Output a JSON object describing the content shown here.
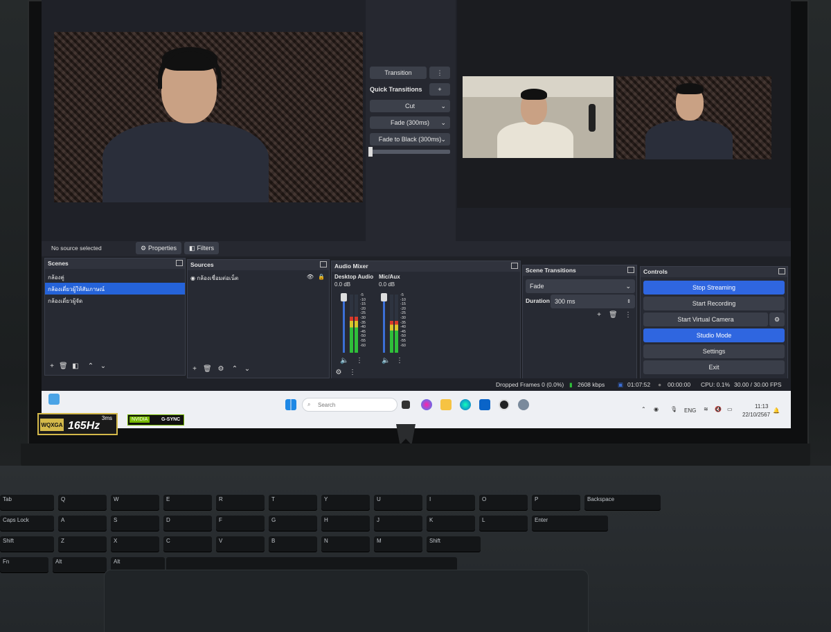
{
  "obs": {
    "transition_label": "Transition",
    "quick_transitions_label": "Quick Transitions",
    "quick_items": [
      "Cut",
      "Fade (300ms)",
      "Fade to Black (300ms)"
    ],
    "no_source_text": "No source selected",
    "properties_label": "Properties",
    "filters_label": "Filters"
  },
  "scenes": {
    "title": "Scenes",
    "items": [
      "กล้องคู่",
      "กล้องเดี่ยวผู้ให้สัมภาษณ์",
      "กล้องเดี่ยวผู้จัด"
    ],
    "selected_index": 1
  },
  "sources": {
    "title": "Sources",
    "items": [
      "กล้องเชื่อมต่อเน็ต"
    ]
  },
  "audio_mixer": {
    "title": "Audio Mixer",
    "channels": [
      {
        "name": "Desktop Audio",
        "db": "0.0 dB"
      },
      {
        "name": "Mic/Aux",
        "db": "0.0 dB"
      }
    ],
    "scale": [
      "-5",
      "-10",
      "-15",
      "-20",
      "-25",
      "-30",
      "-35",
      "-40",
      "-45",
      "-50",
      "-55",
      "-60"
    ]
  },
  "scene_transitions": {
    "title": "Scene Transitions",
    "selected": "Fade",
    "duration_label": "Duration",
    "duration_value": "300 ms"
  },
  "controls": {
    "title": "Controls",
    "buttons": [
      "Stop Streaming",
      "Start Recording",
      "Start Virtual Camera",
      "Studio Mode",
      "Settings",
      "Exit"
    ],
    "active": [
      "Stop Streaming",
      "Studio Mode"
    ]
  },
  "status": {
    "dropped": "Dropped Frames 0 (0.0%)",
    "bitrate": "2608 kbps",
    "stream_time": "01:07:52",
    "rec_time": "00:00:00",
    "cpu": "CPU: 0.1%",
    "fps": "30.00 / 30.00 FPS"
  },
  "taskbar": {
    "search_placeholder": "Search",
    "lang": "ENG",
    "time": "11:13",
    "date": "22/10/2567"
  },
  "stickers": {
    "wqxga": "WQXGA",
    "hz": "165Hz",
    "ms": "3ms",
    "nvidia": "NVIDIA",
    "gsync": "G-SYNC"
  },
  "keyboard": {
    "row1": [
      "Tab",
      "Q",
      "W",
      "E",
      "R",
      "T",
      "Y",
      "U",
      "I",
      "O",
      "P",
      "Backspace"
    ],
    "row2": [
      "Caps Lock",
      "A",
      "S",
      "D",
      "F",
      "G",
      "H",
      "J",
      "K",
      "L",
      "Enter"
    ],
    "row3": [
      "Shift",
      "Z",
      "X",
      "C",
      "V",
      "B",
      "N",
      "M",
      "Shift"
    ],
    "row4": [
      "Fn",
      "Alt",
      "Alt"
    ]
  },
  "colors": {
    "obs_bg": "#1f2128",
    "panel_bg": "#272a33",
    "accent_blue": "#2f66e0",
    "meter_green": "#2fbf3a",
    "meter_yellow": "#d8c52a",
    "meter_red": "#d83a2a"
  }
}
